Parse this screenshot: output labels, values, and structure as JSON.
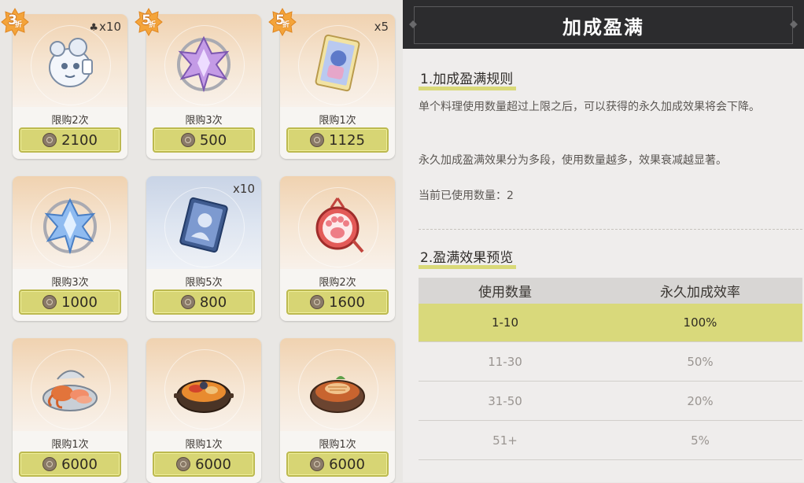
{
  "shop": {
    "items": [
      {
        "badge": "3",
        "badge_suffix": "折",
        "count": "x10",
        "count_icon": "mushroom-icon",
        "icon": "ghost-plush-icon",
        "limit": "限购2次",
        "price": "2100",
        "theme": "orange"
      },
      {
        "badge": "5",
        "badge_suffix": "折",
        "count": "",
        "icon": "purple-crystal-icon",
        "limit": "限购3次",
        "price": "500",
        "theme": "orange"
      },
      {
        "badge": "5",
        "badge_suffix": "折",
        "count": "x5",
        "icon": "character-card-icon",
        "limit": "限购1次",
        "price": "1125",
        "theme": "orange"
      },
      {
        "badge": "",
        "count": "",
        "icon": "blue-crystal-icon",
        "limit": "限购3次",
        "price": "1000",
        "theme": "orange"
      },
      {
        "badge": "",
        "count": "x10",
        "icon": "blue-card-icon",
        "limit": "限购5次",
        "price": "800",
        "theme": "blue"
      },
      {
        "badge": "",
        "count": "",
        "icon": "paw-charm-icon",
        "limit": "限购2次",
        "price": "1600",
        "theme": "orange"
      },
      {
        "badge": "",
        "count": "",
        "icon": "seafood-platter-icon",
        "limit": "限购1次",
        "price": "6000",
        "theme": "orange"
      },
      {
        "badge": "",
        "count": "",
        "icon": "seafood-stew-icon",
        "limit": "限购1次",
        "price": "6000",
        "theme": "orange"
      },
      {
        "badge": "",
        "count": "",
        "icon": "fish-stew-icon",
        "limit": "限购1次",
        "price": "6000",
        "theme": "orange"
      }
    ],
    "currency_icon": "coin-icon"
  },
  "panel": {
    "title": "加成盈满",
    "section1": {
      "title": "1.加成盈满规则",
      "para1": "单个料理使用数量超过上限之后，可以获得的永久加成效果将会下降。",
      "para2": "永久加成盈满效果分为多段，使用数量越多，效果衰减越显著。",
      "current_label": "当前已使用数量：2"
    },
    "section2": {
      "title": "2.盈满效果预览",
      "table": {
        "headers": [
          "使用数量",
          "永久加成效率"
        ],
        "rows": [
          {
            "range": "1-10",
            "rate": "100%",
            "active": true
          },
          {
            "range": "11-30",
            "rate": "50%",
            "active": false
          },
          {
            "range": "31-50",
            "rate": "20%",
            "active": false
          },
          {
            "range": "51+",
            "rate": "5%",
            "active": false
          }
        ]
      }
    }
  },
  "colors": {
    "price_button": "#d7d574",
    "highlight": "#d9d978",
    "header_bg": "#2c2c2e"
  }
}
